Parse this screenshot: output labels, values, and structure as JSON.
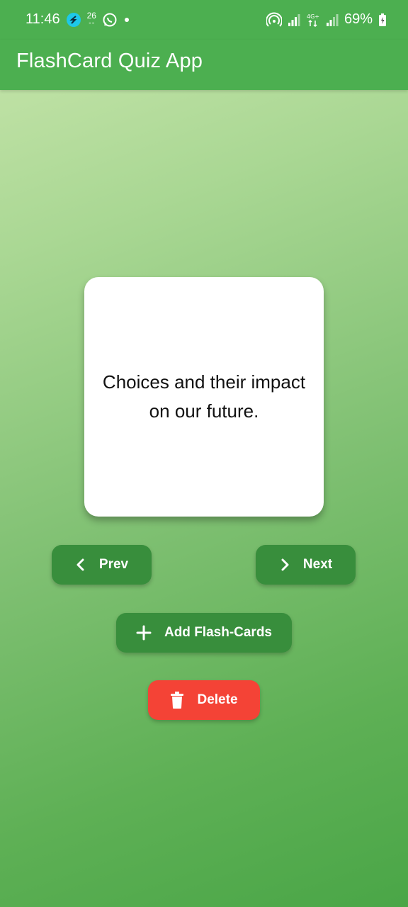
{
  "status_bar": {
    "time": "11:46",
    "notif_badge": "26",
    "battery_percent": "69%"
  },
  "app_bar": {
    "title": "FlashCard Quiz App"
  },
  "card": {
    "text": "Choices and their impact on our future."
  },
  "buttons": {
    "prev_label": "Prev",
    "next_label": "Next",
    "add_label": "Add Flash-Cards",
    "delete_label": "Delete"
  },
  "colors": {
    "app_bar": "#4caf50",
    "button_green": "#388e3c",
    "button_red": "#f44336",
    "card_bg": "#ffffff"
  }
}
